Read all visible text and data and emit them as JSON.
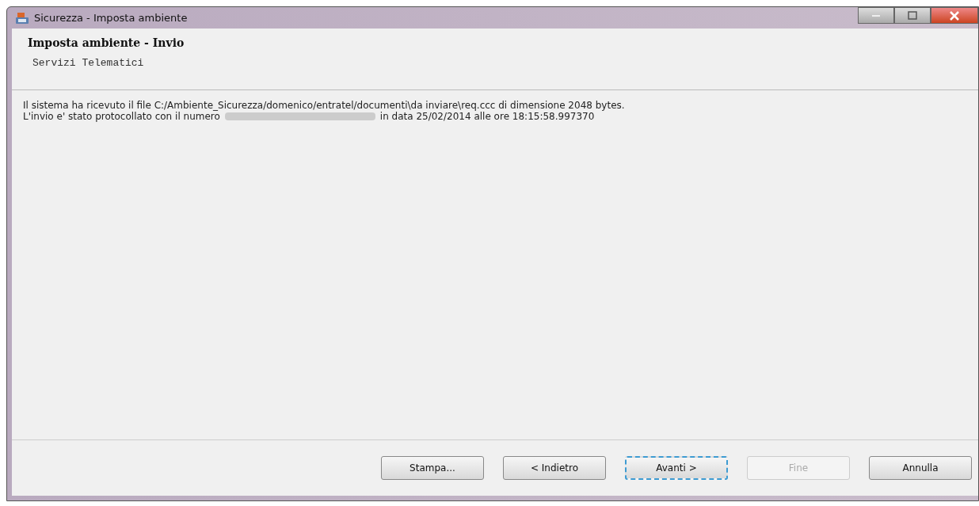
{
  "window": {
    "title": "Sicurezza - Imposta ambiente"
  },
  "header": {
    "title": "Imposta ambiente - Invio",
    "subtitle": "Servizi Telematici"
  },
  "message": {
    "line_1": "Il sistema ha ricevuto il file C:/Ambiente_Sicurezza/domenico/entratel/documenti\\da inviare\\req.ccc di dimensione 2048 bytes.",
    "line_2_start": "L'invio e' stato protocollato con il numero",
    "line_2_end": "in data 25/02/2014 alle ore 18:15:58.997370"
  },
  "buttons": [
    {
      "label": "Stampa...",
      "disabled": false,
      "focused": false
    },
    {
      "label": "< Indietro",
      "disabled": false,
      "focused": false
    },
    {
      "label": "Avanti >",
      "disabled": false,
      "focused": true
    },
    {
      "label": "Fine",
      "disabled": true,
      "focused": false
    },
    {
      "label": "Annulla",
      "disabled": false,
      "focused": false
    }
  ]
}
